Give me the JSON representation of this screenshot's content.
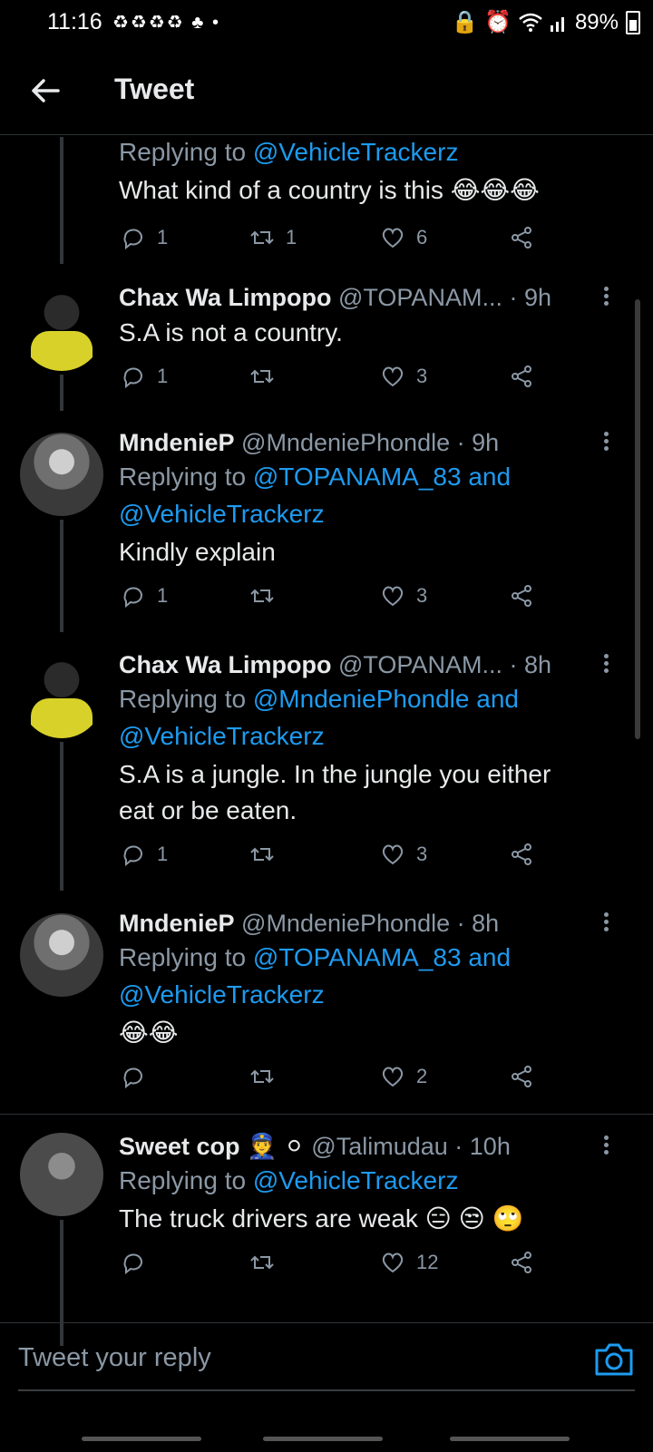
{
  "status": {
    "time": "11:16",
    "notifs": "♻♻♻♻ ♣ •",
    "right_icons": "🔒 ⏰",
    "battery": "89%"
  },
  "header": {
    "title": "Tweet"
  },
  "tweets": [
    {
      "reply_prefix": "Replying to ",
      "reply_to": "@VehicleTrackerz",
      "text": "What kind of a country is this 😂😂😂",
      "replies": "1",
      "retweets": "1",
      "likes": "6"
    },
    {
      "name": "Chax Wa Limpopo",
      "handle": "@TOPANAM...",
      "time": "· 9h",
      "text": "S.A is not a country.",
      "replies": "1",
      "retweets": "",
      "likes": "3"
    },
    {
      "name": "MndenieP",
      "handle": "@MndeniePhondle",
      "time": "· 9h",
      "reply_prefix": "Replying to ",
      "reply_to_line1": "@TOPANAMA_83 and",
      "reply_to_line2": "@VehicleTrackerz",
      "text": "Kindly explain",
      "replies": "1",
      "retweets": "",
      "likes": "3"
    },
    {
      "name": "Chax Wa Limpopo",
      "handle": "@TOPANAM...",
      "time": "· 8h",
      "reply_prefix": "Replying to ",
      "reply_to_line1": "@MndeniePhondle and",
      "reply_to_line2": "@VehicleTrackerz",
      "text_line1": "S.A is a jungle. In the jungle you either",
      "text_line2": "eat or be eaten.",
      "replies": "1",
      "retweets": "",
      "likes": "3"
    },
    {
      "name": "MndenieP",
      "handle": "@MndeniePhondle",
      "time": "· 8h",
      "reply_prefix": "Replying to ",
      "reply_to_line1": "@TOPANAMA_83 and",
      "reply_to_line2": "@VehicleTrackerz",
      "text": "😂😂",
      "replies": "",
      "retweets": "",
      "likes": "2"
    },
    {
      "name": "Sweet cop 👮 ⚪",
      "handle": "@Talimudau",
      "time": "· 10h",
      "reply_prefix": "Replying to ",
      "reply_to": "@VehicleTrackerz",
      "text": "The truck drivers are weak 😑 😒 🙄",
      "replies": "",
      "retweets": "",
      "likes": "12"
    }
  ],
  "composer": {
    "placeholder": "Tweet your reply"
  },
  "icons": {
    "back": "back-arrow-icon",
    "reply": "reply-icon",
    "retweet": "retweet-icon",
    "like": "heart-icon",
    "share": "share-icon",
    "more": "more-icon",
    "camera": "camera-icon"
  },
  "colors": {
    "accent": "#1d9bf0",
    "muted": "#8b98a5",
    "bg": "#000000",
    "text": "#e7e9ea"
  }
}
